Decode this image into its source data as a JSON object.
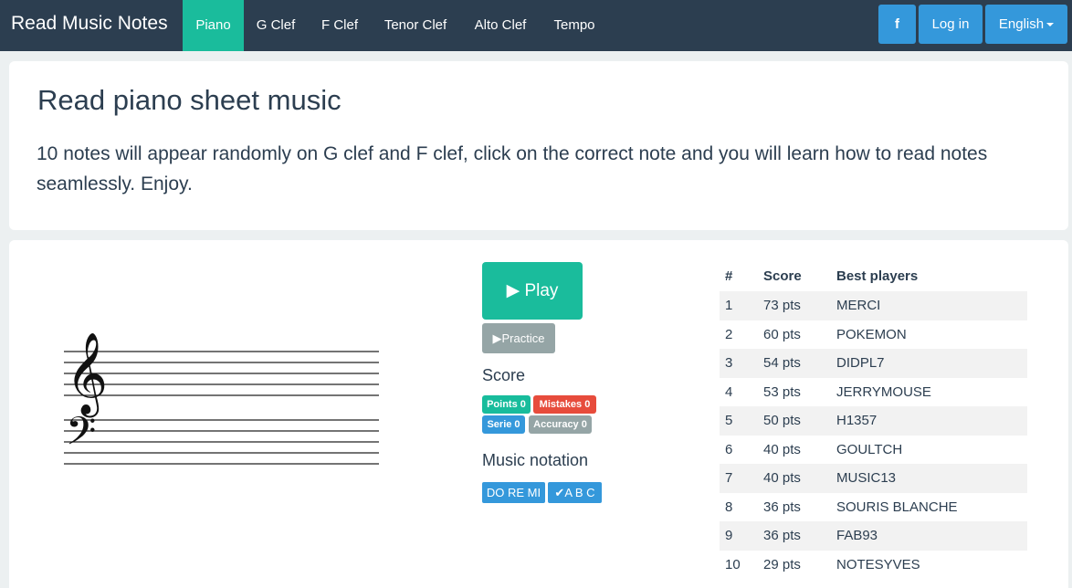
{
  "header": {
    "brand": "Read Music Notes",
    "nav": [
      "Piano",
      "G Clef",
      "F Clef",
      "Tenor Clef",
      "Alto Clef",
      "Tempo"
    ],
    "active": "Piano",
    "facebook_glyph": "f",
    "login": "Log in",
    "language": "English"
  },
  "intro": {
    "title": "Read piano sheet music",
    "text": "10 notes will appear randomly on G clef and F clef, click on the correct note and you will learn how to read notes seamlessly. Enjoy."
  },
  "game": {
    "play": "▶ Play",
    "practice": "▶Practice",
    "score_heading": "Score",
    "labels": {
      "points": "Points 0",
      "mistakes": "Mistakes 0",
      "serie": "Serie 0",
      "accuracy": "Accuracy 0"
    },
    "notation_heading": "Music notation",
    "notation": {
      "doremi": "DO RE MI",
      "abc": "✔A B C"
    }
  },
  "colors": {
    "navbar": "#2c3e50",
    "active": "#1abc9c",
    "primary": "#3498db",
    "danger": "#e74c3c",
    "muted": "#95a5a6"
  },
  "leaderboard": {
    "headers": [
      "#",
      "Score",
      "Best players"
    ],
    "rows": [
      {
        "rank": "1",
        "score": "73 pts",
        "name": "MERCI"
      },
      {
        "rank": "2",
        "score": "60 pts",
        "name": "POKEMON"
      },
      {
        "rank": "3",
        "score": "54 pts",
        "name": "DIDPL7"
      },
      {
        "rank": "4",
        "score": "53 pts",
        "name": "JERRYMOUSE"
      },
      {
        "rank": "5",
        "score": "50 pts",
        "name": "H1357"
      },
      {
        "rank": "6",
        "score": "40 pts",
        "name": "GOULTCH"
      },
      {
        "rank": "7",
        "score": "40 pts",
        "name": "MUSIC13"
      },
      {
        "rank": "8",
        "score": "36 pts",
        "name": "SOURIS BLANCHE"
      },
      {
        "rank": "9",
        "score": "36 pts",
        "name": "FAB93"
      },
      {
        "rank": "10",
        "score": "29 pts",
        "name": "NOTESYVES"
      }
    ]
  }
}
